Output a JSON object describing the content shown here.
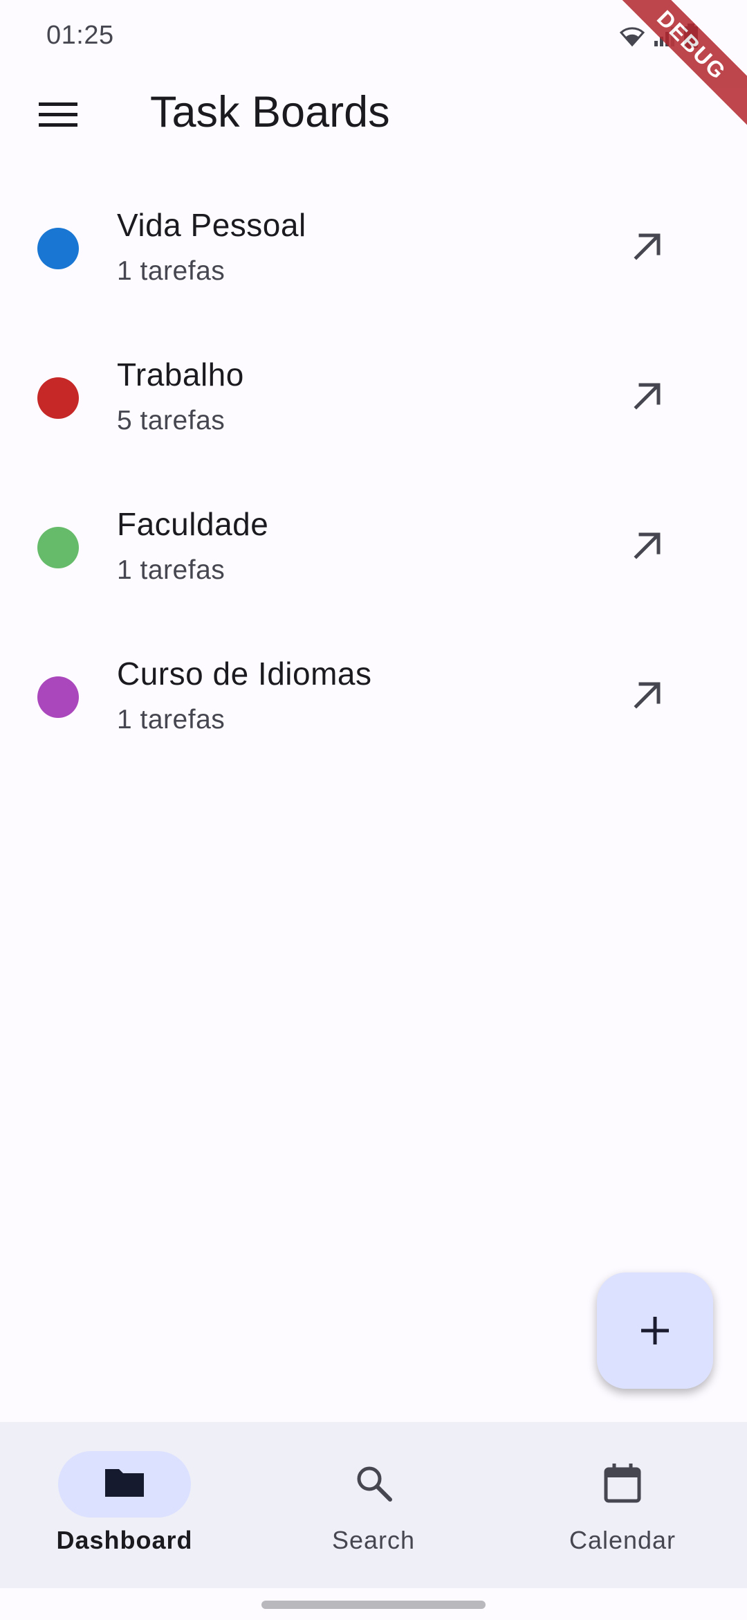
{
  "status_bar": {
    "time": "01:25",
    "icons": [
      "wifi-icon",
      "signal-icon",
      "battery-icon"
    ]
  },
  "debug_banner": "DEBUG",
  "app_bar": {
    "title": "Task Boards",
    "menu_icon": "hamburger-menu-icon"
  },
  "boards": [
    {
      "name": "Vida Pessoal",
      "count": "1 tarefas",
      "color": "#1976d2"
    },
    {
      "name": "Trabalho",
      "count": "5 tarefas",
      "color": "#c62828"
    },
    {
      "name": "Faculdade",
      "count": "1 tarefas",
      "color": "#66bb6a"
    },
    {
      "name": "Curso de Idiomas",
      "count": "1 tarefas",
      "color": "#ab47bc"
    }
  ],
  "fab": {
    "icon": "plus-icon"
  },
  "bottom_nav": {
    "items": [
      {
        "label": "Dashboard",
        "icon": "folder-icon",
        "active": true
      },
      {
        "label": "Search",
        "icon": "search-icon",
        "active": false
      },
      {
        "label": "Calendar",
        "icon": "calendar-icon",
        "active": false
      }
    ]
  },
  "colors": {
    "background": "#fdfbff",
    "nav_background": "#efeff8",
    "active_pill": "#dce1ff",
    "fab_background": "#dce1ff"
  }
}
